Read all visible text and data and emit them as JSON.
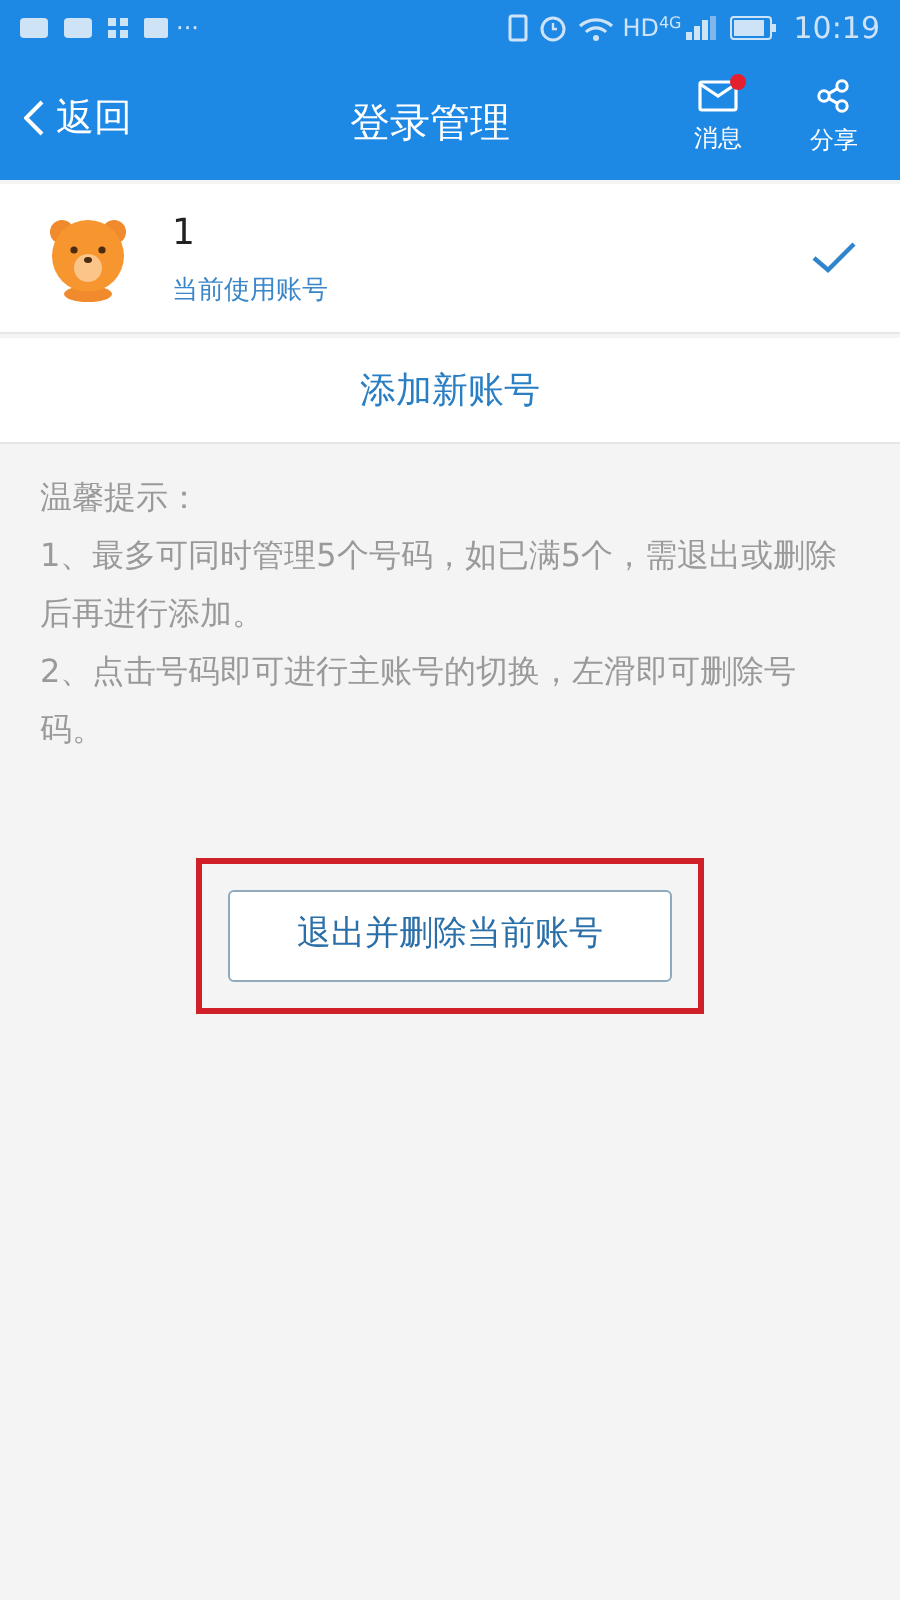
{
  "status_bar": {
    "more": "···",
    "network": "HD",
    "network_type": "4G",
    "time": "10:19"
  },
  "header": {
    "back": "返回",
    "title": "登录管理",
    "actions": [
      {
        "kind": "message",
        "label": "消息",
        "unread": true
      },
      {
        "kind": "share",
        "label": "分享",
        "unread": false
      }
    ]
  },
  "accounts": [
    {
      "name": "1",
      "subtitle": "当前使用账号",
      "selected": true
    }
  ],
  "add_account": "添加新账号",
  "tips": {
    "title": "温馨提示：",
    "items": [
      "1、最多可同时管理5个号码，如已满5个，需退出或删除后再进行添加。",
      "2、点击号码即可进行主账号的切换，左滑即可删除号码。"
    ]
  },
  "logout_button": {
    "label": "退出并删除当前账号",
    "highlighted": true
  }
}
